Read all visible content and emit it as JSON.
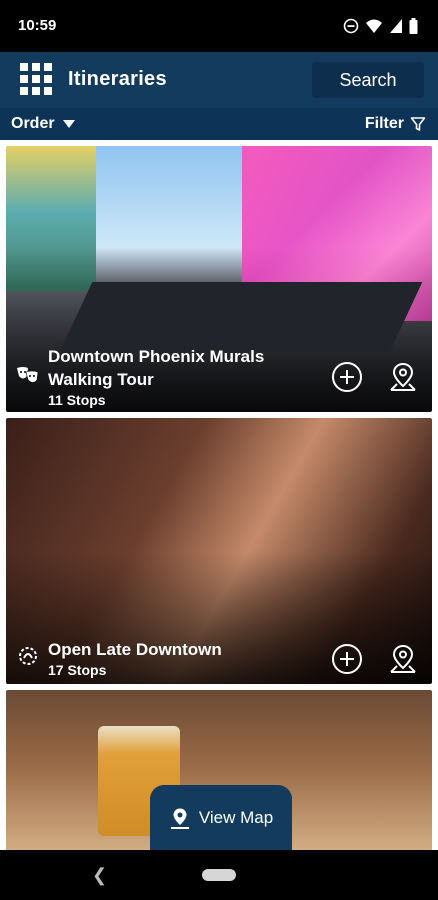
{
  "status": {
    "time": "10:59"
  },
  "header": {
    "title": "Itineraries",
    "search_label": "Search"
  },
  "toolbar": {
    "order_label": "Order",
    "filter_label": "Filter"
  },
  "cards": [
    {
      "title_line1": "Downtown Phoenix Murals",
      "title_line2": "Walking Tour",
      "stops": "11 Stops",
      "type_icon": "theater-masks-icon"
    },
    {
      "title_line1": "Open Late Downtown",
      "title_line2": "",
      "stops": "17 Stops",
      "type_icon": "nightlife-icon"
    },
    {
      "title_line1": "",
      "title_line2": "",
      "stops": "",
      "type_icon": ""
    }
  ],
  "floating": {
    "view_map_label": "View Map"
  },
  "colors": {
    "primary": "#123b5e",
    "primary_dark": "#0d3356"
  }
}
